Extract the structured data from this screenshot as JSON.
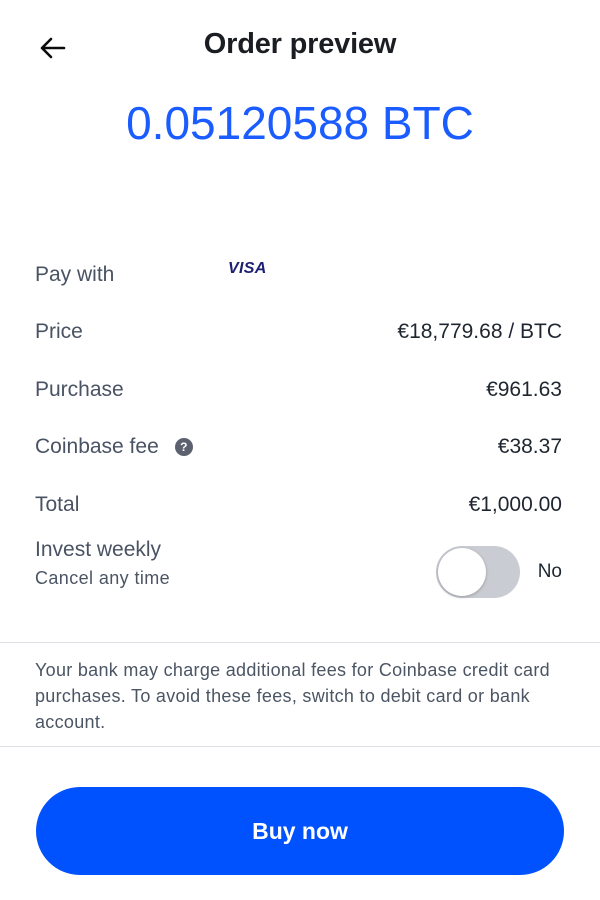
{
  "header": {
    "title": "Order preview",
    "back_icon": "arrow-left-icon"
  },
  "order": {
    "amount": "0.05120588 BTC"
  },
  "details": {
    "pay_with_label": "Pay with",
    "pay_with_method": "VISA",
    "price_label": "Price",
    "price_value": "€18,779.68 / BTC",
    "purchase_label": "Purchase",
    "purchase_value": "€961.63",
    "fee_label": "Coinbase fee",
    "fee_icon": "question-mark-icon",
    "fee_icon_glyph": "?",
    "fee_value": "€38.37",
    "total_label": "Total",
    "total_value": "€1,000.00",
    "invest_label": "Invest weekly",
    "invest_sublabel": "Cancel any time",
    "invest_toggle_state": "No"
  },
  "notice": {
    "text": "Your bank may charge additional fees for Coinbase credit card purchases. To avoid these fees, switch to debit card or bank account."
  },
  "actions": {
    "buy_label": "Buy now"
  },
  "colors": {
    "accent": "#0052ff",
    "amount": "#1a5cff",
    "toggle_off": "#c9ccd2"
  }
}
